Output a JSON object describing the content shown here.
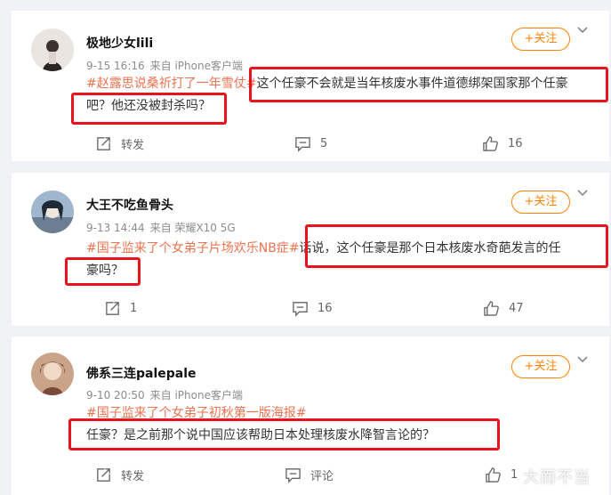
{
  "comments": [
    {
      "username": "极地少女lili",
      "date": "9-15 16:16",
      "source": "来自 iPhone客户端",
      "follow_label": "+关注",
      "hashtag": "#赵露思说桑祈打了一年雪仗#",
      "text_line1": "这个任豪不会就是当年核废水事件道德绑架国家那个任豪",
      "text_line2": "吧？他还没被封杀吗？",
      "repost_label": "转发",
      "comment_count": "5",
      "like_count": "16"
    },
    {
      "username": "大王不吃鱼骨头",
      "date": "9-13 14:44",
      "source": "来自 荣耀X10 5G",
      "follow_label": "+关注",
      "hashtag": "#国子监来了个女弟子片场欢乐NB症#",
      "text_line1": "话说，这个任豪是那个日本核废水奇葩发言的任",
      "text_line2": "豪吗？",
      "repost_count": "1",
      "comment_count": "16",
      "like_count": "47"
    },
    {
      "username": "佛系三连palepale",
      "date": "9-10 20:50",
      "source": "来自 iPhone客户端",
      "follow_label": "+关注",
      "hashtag": "#国子监来了个女弟子初秋第一版海报#",
      "text_line1": "任豪？是之前那个说中国应该帮助日本处理核废水降智言论的？",
      "repost_label": "转发",
      "comment_label": "评论",
      "like_count": "1"
    }
  ],
  "watermark": "大而不当",
  "colors": {
    "accent": "#ff8200",
    "hashtag": "#eb7350",
    "highlight_box": "#e8131c"
  },
  "icons": [
    "chevron-down-icon",
    "repost-icon",
    "comment-icon",
    "like-icon"
  ]
}
